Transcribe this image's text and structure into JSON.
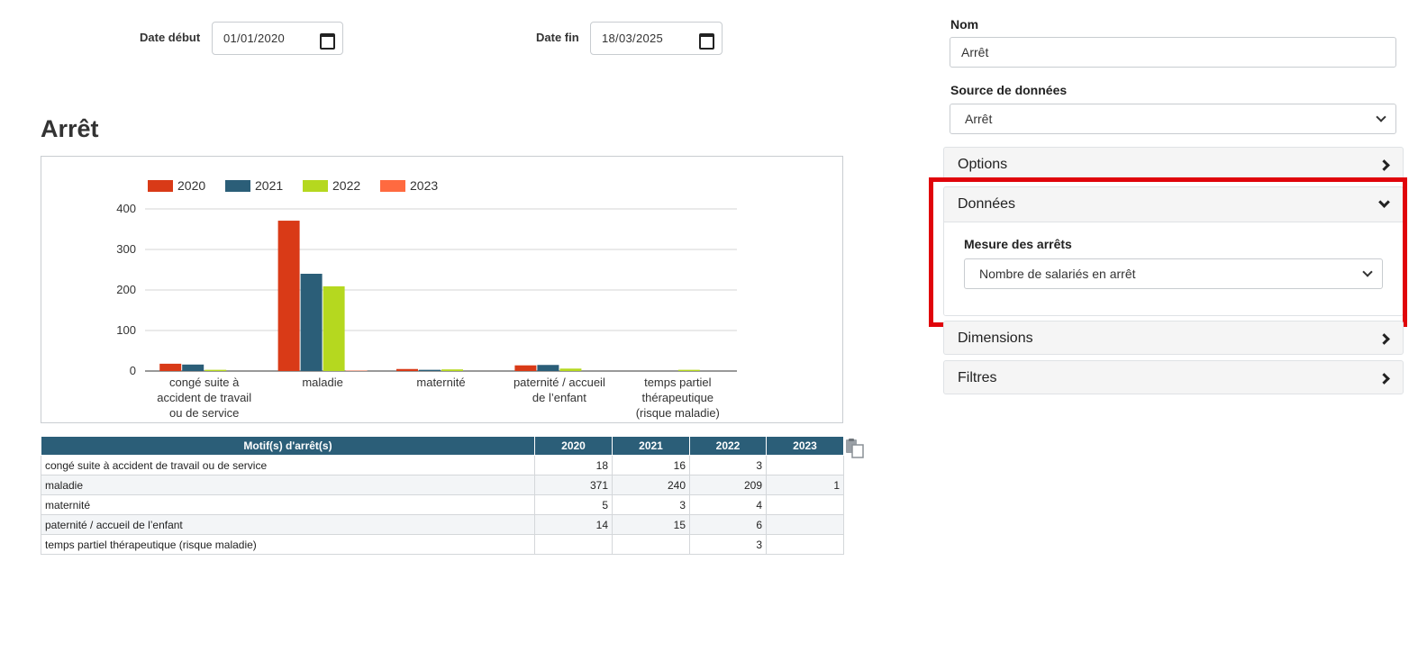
{
  "filters": {
    "start_label": "Date début",
    "start_value": "01/01/2020",
    "end_label": "Date fin",
    "end_value": "18/03/2025"
  },
  "page_title": "Arrêt",
  "chart_data": {
    "type": "bar",
    "categories": [
      [
        "congé suite à",
        "accident de travail",
        "ou de service"
      ],
      [
        "maladie"
      ],
      [
        "maternité"
      ],
      [
        "paternité / accueil",
        "de l’enfant"
      ],
      [
        "temps partiel",
        "thérapeutique",
        "(risque maladie)"
      ]
    ],
    "series": [
      {
        "name": "2020",
        "color": "#d93a17",
        "values": [
          18,
          371,
          5,
          14,
          0
        ]
      },
      {
        "name": "2021",
        "color": "#2b5e78",
        "values": [
          16,
          240,
          3,
          15,
          0
        ]
      },
      {
        "name": "2022",
        "color": "#b5d81f",
        "values": [
          3,
          209,
          4,
          6,
          3
        ]
      },
      {
        "name": "2023",
        "color": "#ff6a40",
        "values": [
          0,
          1,
          0,
          0,
          0
        ]
      }
    ],
    "ylim": [
      0,
      400
    ],
    "yticks": [
      0,
      100,
      200,
      300,
      400
    ],
    "grid": true,
    "legend": "top-left"
  },
  "table": {
    "headers": [
      "Motif(s) d'arrêt(s)",
      "2020",
      "2021",
      "2022",
      "2023"
    ],
    "rows": [
      [
        "congé suite à accident de travail ou de service",
        "18",
        "16",
        "3",
        ""
      ],
      [
        "maladie",
        "371",
        "240",
        "209",
        "1"
      ],
      [
        "maternité",
        "5",
        "3",
        "4",
        ""
      ],
      [
        "paternité / accueil de l’enfant",
        "14",
        "15",
        "6",
        ""
      ],
      [
        "temps partiel thérapeutique (risque maladie)",
        "",
        "",
        "3",
        ""
      ]
    ]
  },
  "panel": {
    "name_label": "Nom",
    "name_value": "Arrêt",
    "source_label": "Source de données",
    "source_value": "Arrêt",
    "sections": {
      "options": "Options",
      "donnees": "Données",
      "dimensions": "Dimensions",
      "filtres": "Filtres"
    },
    "measure_label": "Mesure des arrêts",
    "measure_value": "Nombre de salariés en arrêt"
  },
  "colors": {
    "highlight": "#e0040b",
    "table_header": "#2b5e78"
  }
}
